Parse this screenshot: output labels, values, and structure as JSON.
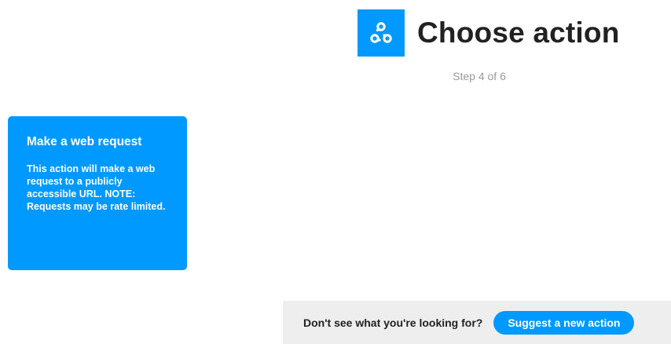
{
  "header": {
    "service_icon": "webhooks-icon",
    "title": "Choose action",
    "step": "Step 4 of 6"
  },
  "actions": [
    {
      "title": "Make a web request",
      "description": "This action will make a web request to a publicly accessible URL. NOTE: Requests may be rate limited."
    }
  ],
  "suggest": {
    "prompt": "Don't see what you're looking for?",
    "button_label": "Suggest a new action"
  },
  "colors": {
    "accent": "#0099ff",
    "suggest_bar_bg": "#eeeeee",
    "step_text": "#999999",
    "title_text": "#222222"
  }
}
